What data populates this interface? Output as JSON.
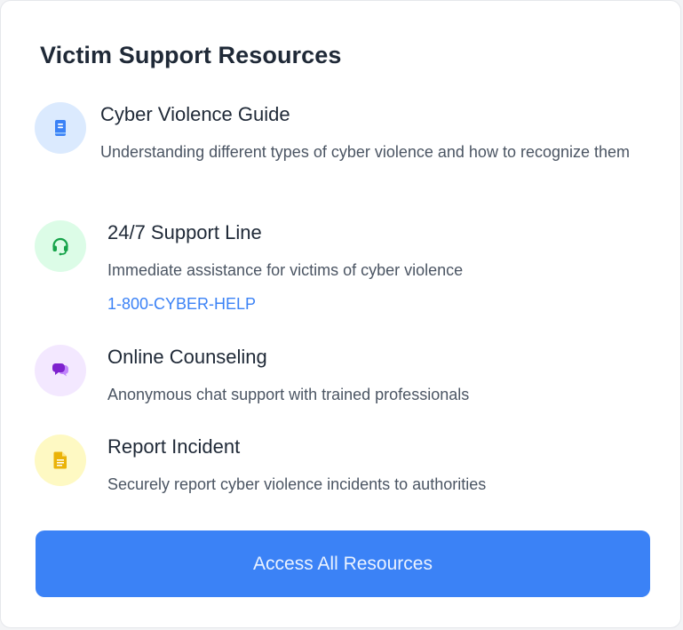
{
  "card": {
    "title": "Victim Support Resources"
  },
  "resources": [
    {
      "title": "Cyber Violence Guide",
      "description": "Understanding different types of cyber violence and how to recognize them",
      "icon": "book-icon",
      "icon_bg": "#dbeafe",
      "icon_color": "#3b82f6"
    },
    {
      "title": "24/7 Support Line",
      "description": "Immediate assistance for victims of cyber violence",
      "link": "1-800-CYBER-HELP",
      "icon": "headset-icon",
      "icon_bg": "#dcfce7",
      "icon_color": "#16a34a"
    },
    {
      "title": "Online Counseling",
      "description": "Anonymous chat support with trained professionals",
      "icon": "chat-bubbles-icon",
      "icon_bg": "#f3e8ff",
      "icon_color": "#9333ea"
    },
    {
      "title": "Report Incident",
      "description": "Securely report cyber violence incidents to authorities",
      "icon": "document-icon",
      "icon_bg": "#fef9c3",
      "icon_color": "#eab308"
    }
  ],
  "cta": {
    "label": "Access All Resources"
  },
  "colors": {
    "accent": "#3b82f6",
    "title_text": "#1f2937",
    "body_text": "#4b5563"
  }
}
